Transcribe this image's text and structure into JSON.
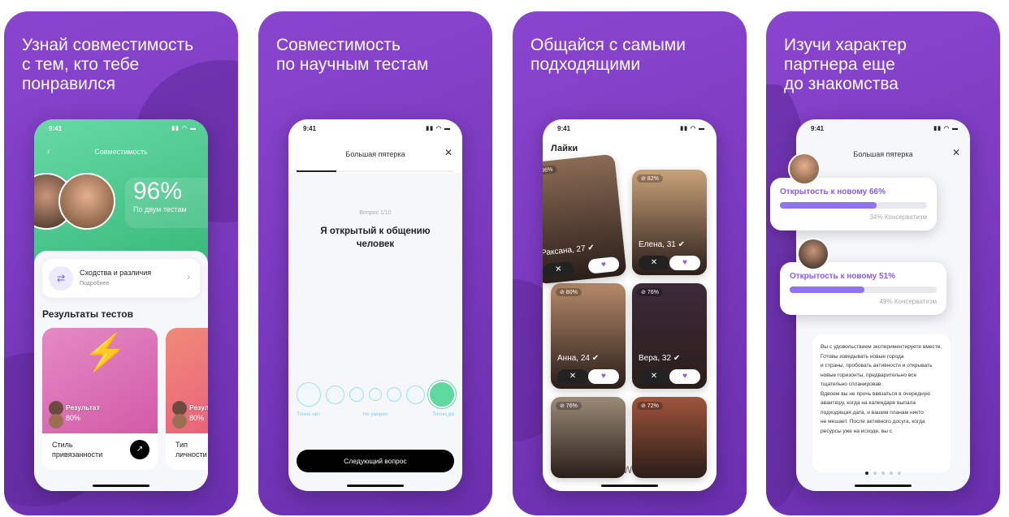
{
  "panels": [
    {
      "headline": "Узнай совместимость\nс тем, кто тебе\nпонравился"
    },
    {
      "headline": "Совместимость\nпо научным тестам"
    },
    {
      "headline": "Общайся с самыми\nподходящими"
    },
    {
      "headline": "Изучи характер\nпартнера еще\nдо знакомства"
    }
  ],
  "status_time": "9:41",
  "compat": {
    "title": "Совместимость",
    "percent": "96%",
    "subtitle": "По двум тестам",
    "similar_title": "Сходства и различия",
    "similar_sub": "Подробнее",
    "results_heading": "Результаты тестов",
    "tests": [
      {
        "result_label": "Результат",
        "result": "80%",
        "name": "Стиль\nпривязанности"
      },
      {
        "result_label": "Резуль",
        "result": "80%",
        "name": "Тип\nличности"
      }
    ]
  },
  "quiz": {
    "title": "Большая пятерка",
    "progress": 0.25,
    "counter": "Вопрос 1/10",
    "question": "Я открытый к общению человек",
    "scale_left": "Точно нет",
    "scale_mid": "Не уверен",
    "scale_right": "Точно да",
    "selected_index": 6,
    "next_button": "Следующий вопрос"
  },
  "likes": {
    "title": "Лайки",
    "cards": [
      {
        "name": "Раксана, 27",
        "match": "86%"
      },
      {
        "name": "Елена, 31",
        "match": "82%"
      },
      {
        "name": "Анна, 24",
        "match": "80%"
      },
      {
        "name": "Вера, 32",
        "match": "76%"
      },
      {
        "name": "",
        "match": "76%"
      },
      {
        "name": "",
        "match": "72%"
      }
    ]
  },
  "traits": {
    "title": "Большая пятерка",
    "items": [
      {
        "label": "Открытость к новому 66%",
        "value": 66,
        "opposite": "34% Консерватизм"
      },
      {
        "label": "Открытость к новому 51%",
        "value": 51,
        "opposite": "49% Консерватизм"
      }
    ],
    "description": "Вы с удовольствием экспериментируете вместе. Готовы изведывать новые города\nи страны, пробовать активности и открывать новые горизонты, предварительно все тщательно спланировав.\nВдвоем вы не прочь ввязаться в очередную авантюру, когда на календаре выпала подходящая дата, и вашим планам никто\nне мешает. После активного досуга, когда ресурсы уже на исходе, вы с",
    "page_dots": 5,
    "active_dot": 0
  },
  "colors": {
    "brand_purple": "#7b3fc0",
    "accent_violet": "#8f73f0",
    "match_green": "#5fd9a0"
  }
}
